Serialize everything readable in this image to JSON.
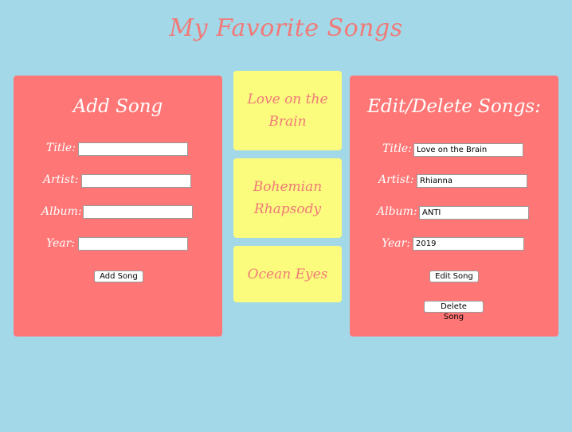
{
  "page": {
    "title": "My Favorite Songs"
  },
  "add_panel": {
    "heading": "Add Song",
    "labels": {
      "title": "Title:",
      "artist": "Artist:",
      "album": "Album:",
      "year": "Year:"
    },
    "values": {
      "title": "",
      "artist": "",
      "album": "",
      "year": ""
    },
    "button_label": "Add Song"
  },
  "songs": [
    {
      "title": "Love on the Brain"
    },
    {
      "title": "Bohemian Rhapsody"
    },
    {
      "title": "Ocean Eyes"
    }
  ],
  "edit_panel": {
    "heading": "Edit/Delete Songs:",
    "labels": {
      "title": "Title:",
      "artist": "Artist:",
      "album": "Album:",
      "year": "Year:"
    },
    "values": {
      "title": "Love on the Brain",
      "artist": "Rhianna",
      "album": "ANTI",
      "year": "2019"
    },
    "edit_button_label": "Edit Song",
    "delete_button_label": "Delete Song"
  },
  "colors": {
    "background": "#a3d8e8",
    "panel": "#ff7676",
    "card": "#fbfb7e",
    "accent_text": "#f07a78"
  }
}
